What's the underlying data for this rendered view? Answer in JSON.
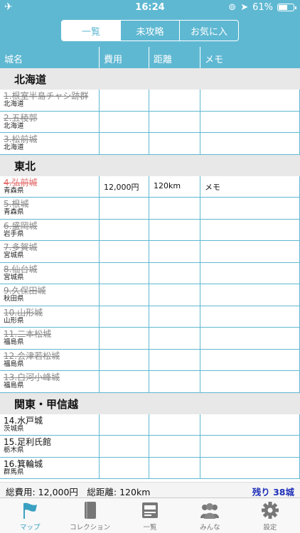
{
  "status": {
    "time": "16:24",
    "battery": "61%",
    "battery_level": 0.61
  },
  "segments": [
    "一覧",
    "未攻略",
    "お気に入"
  ],
  "columns": [
    "城名",
    "費用",
    "距離",
    "メモ"
  ],
  "sections": [
    {
      "title": "北海道",
      "rows": [
        {
          "name": "1.根室半島チャシ跡群",
          "pref": "北海道",
          "done": true
        },
        {
          "name": "2.五稜郭",
          "pref": "北海道",
          "done": true
        },
        {
          "name": "3.松前城",
          "pref": "北海道",
          "done": true
        }
      ]
    },
    {
      "title": "東北",
      "rows": [
        {
          "name": "4.弘前城",
          "pref": "青森県",
          "done": true,
          "red": true,
          "cost": "12,000円",
          "dist": "120km",
          "memo": "メモ"
        },
        {
          "name": "5.根城",
          "pref": "青森県",
          "done": true
        },
        {
          "name": "6.盛岡城",
          "pref": "岩手県",
          "done": true
        },
        {
          "name": "7.多賀城",
          "pref": "宮城県",
          "done": true
        },
        {
          "name": "8.仙台城",
          "pref": "宮城県",
          "done": true
        },
        {
          "name": "9.久保田城",
          "pref": "秋田県",
          "done": true
        },
        {
          "name": "10.山形城",
          "pref": "山形県",
          "done": true
        },
        {
          "name": "11.二本松城",
          "pref": "福島県",
          "done": true
        },
        {
          "name": "12.会津若松城",
          "pref": "福島県",
          "done": true
        },
        {
          "name": "13.白河小峰城",
          "pref": "福島県",
          "done": true
        }
      ]
    },
    {
      "title": "関東・甲信越",
      "rows": [
        {
          "name": "14.水戸城",
          "pref": "茨城県",
          "done": false
        },
        {
          "name": "15.足利氏館",
          "pref": "栃木県",
          "done": false
        },
        {
          "name": "16.箕輪城",
          "pref": "群馬県",
          "done": false
        }
      ]
    }
  ],
  "footer": {
    "totals": "総費用: 12,000円　総距離: 120km",
    "remaining": "残り 38城"
  },
  "tabs": [
    {
      "label": "マップ",
      "icon": "flag-icon",
      "active": true
    },
    {
      "label": "コレクション",
      "icon": "book-icon",
      "active": false
    },
    {
      "label": "一覧",
      "icon": "list-icon",
      "active": false
    },
    {
      "label": "みんな",
      "icon": "people-icon",
      "active": false
    },
    {
      "label": "設定",
      "icon": "gear-icon",
      "active": false
    }
  ],
  "colors": {
    "accent": "#5fb8d2",
    "remaining": "#1f2fb8",
    "highlight": "#e36a6a"
  }
}
